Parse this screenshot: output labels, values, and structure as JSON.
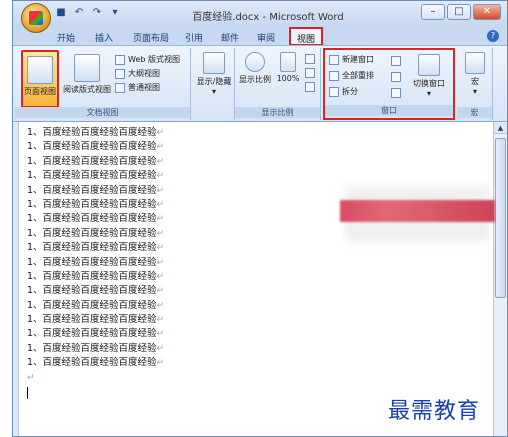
{
  "window": {
    "title": "百度经验.docx - Microsoft Word",
    "controls": {
      "minimize": "–",
      "maximize": "□",
      "close": "✕"
    }
  },
  "quick_access": {
    "icons": [
      "save-icon",
      "undo-icon",
      "redo-icon",
      "customize-icon"
    ],
    "glyphs": [
      "■",
      "↶",
      "↷",
      "▾"
    ]
  },
  "tabs": [
    "开始",
    "插入",
    "页面布局",
    "引用",
    "邮件",
    "审阅",
    "视图"
  ],
  "active_tab": "视图",
  "ribbon": {
    "doc_views": {
      "label": "文档视图",
      "print_layout": "页面视图",
      "full_screen": "阅读版式视图",
      "web": "Web 版式视图",
      "outline": "大纲视图",
      "draft": "普通视图"
    },
    "show_hide": {
      "label": "显示/隐藏"
    },
    "zoom": {
      "label": "显示比例",
      "zoom_btn": "显示比例",
      "hundred": "100%"
    },
    "window": {
      "label": "窗口",
      "new_window": "新建窗口",
      "arrange_all": "全部重排",
      "split": "拆分",
      "switch": "切换窗口"
    },
    "macros": {
      "label": "宏",
      "btn": "宏"
    }
  },
  "document": {
    "lines": [
      "1、百度经验百度经验百度经验",
      "1、百度经验百度经验百度经验",
      "1、百度经验百度经验百度经验",
      "1、百度经验百度经验百度经验",
      "1、百度经验百度经验百度经验",
      "1、百度经验百度经验百度经验",
      "1、百度经验百度经验百度经验",
      "1、百度经验百度经验百度经验",
      "1、百度经验百度经验百度经验",
      "1、百度经验百度经验百度经验",
      "1、百度经验百度经验百度经验",
      "1、百度经验百度经验百度经验",
      "1、百度经验百度经验百度经验",
      "1、百度经验百度经验百度经验",
      "1、百度经验百度经验百度经验",
      "1、百度经验百度经验百度经验",
      "1、百度经验百度经验百度经验"
    ],
    "paragraph_mark": "↵"
  },
  "watermark": "最需教育",
  "colors": {
    "highlight": "#d9242a",
    "ribbon": "#d6e4f6",
    "accent": "#1a3fae"
  }
}
